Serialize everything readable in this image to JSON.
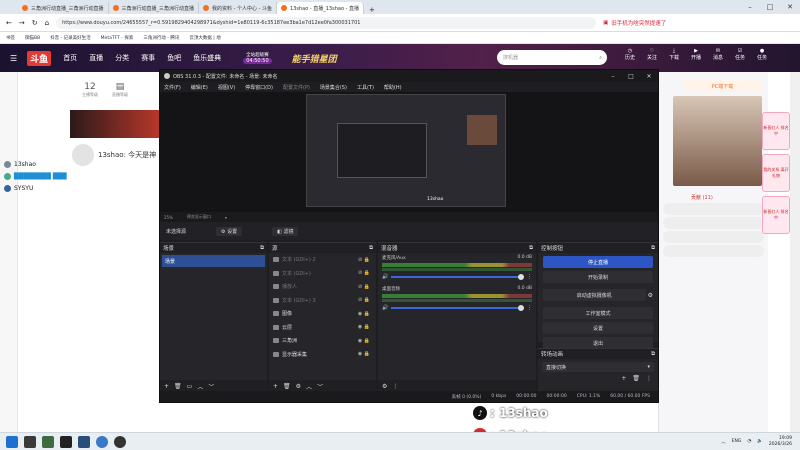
{
  "browser": {
    "tabs": [
      {
        "title": "三角洲行动直播_三角洲行动直播",
        "active": false
      },
      {
        "title": "三角洲行动直播_三角洲行动直播",
        "active": false
      },
      {
        "title": "我的资料 - 个人中心 - 斗鱼",
        "active": false
      },
      {
        "title": "13shao - 直播_13shao - 直播",
        "active": true
      }
    ],
    "url": "https://www.douyu.com/24655557_r=0.5919829404298971&dyshid=1e80119-6c35187ee3ba1e7d12ee0fa300031701",
    "url_right": "旧手机为啥突然提速了",
    "bookmarks": [
      "书签",
      "御猫BB",
      "抖音 - 记录美好生活",
      "MetaTFT - 探索",
      "三角洲行动 - 腾讯",
      "云顶大数据 | 地"
    ]
  },
  "site": {
    "logo": "斗鱼",
    "nav": [
      "首页",
      "直播",
      "分类",
      "赛事",
      "鱼吧",
      "鱼乐盛典"
    ],
    "countdown_label": "全站超级赛",
    "countdown": "04:50:50",
    "banner_text": "能手猎星团",
    "search_placeholder": "搜机器",
    "header_icons": [
      "历史",
      "关注",
      "下载",
      "开播",
      "消息",
      "任务",
      "任务"
    ],
    "room_level": "12",
    "room_level_label": "主播等级",
    "room_rank_label": "直播等级",
    "streamer_name": "13shao: 今天是神",
    "viewers": [
      {
        "name": "13shao"
      },
      {
        "name": "████████ ███"
      },
      {
        "name": "SYSYU"
      }
    ],
    "right_panel_badge": "PC端下载",
    "right_tab": "贡献 (11)",
    "ads": [
      "新晋红人 排名中",
      "我的关系 离开礼物",
      "新晋红人 排名中"
    ]
  },
  "obs": {
    "title": "OBS 31.0.3 - 配置文件: 未命名 - 场景: 未命名",
    "menu": [
      "文件(F)",
      "编辑(E)",
      "视图(V)",
      "停靠窗口(D)",
      "配置文件(P)",
      "场景集合(S)",
      "工具(T)",
      "帮助(H)"
    ],
    "preview_bar": [
      "25%",
      "预览显示窗口"
    ],
    "preview_watermark": "13shao",
    "scene_tools": {
      "label": "未选择源",
      "settings": "设置",
      "filters": "滤镜"
    },
    "docks": {
      "scenes": {
        "title": "场景",
        "items": [
          "场景"
        ]
      },
      "sources": {
        "title": "源",
        "items": [
          {
            "name": "文本 (GDI+) 2",
            "dim": true
          },
          {
            "name": "文本 (GDI+)",
            "dim": true
          },
          {
            "name": "播放人",
            "dim": true
          },
          {
            "name": "文本 (GDI+) 3",
            "dim": true
          },
          {
            "name": "图像",
            "dim": false
          },
          {
            "name": "云层",
            "dim": false
          },
          {
            "name": "三角洲",
            "dim": false
          },
          {
            "name": "显示器采集",
            "dim": false
          }
        ]
      },
      "mixer": {
        "title": "混音器",
        "channels": [
          {
            "name": "麦克风/Aux",
            "db": "0.0 dB"
          },
          {
            "name": "桌面音频",
            "db": "0.0 dB"
          }
        ]
      },
      "controls": {
        "title": "控制按钮",
        "buttons": [
          "停止直播",
          "开始录制",
          "启动虚拟摄像机",
          "工作室模式",
          "设置",
          "退出"
        ]
      },
      "transitions": {
        "title": "转场动画",
        "value": "直接切换"
      }
    },
    "status": [
      "丢帧 0 (0.0%)",
      "0 kbps",
      "00:00:00",
      "00:00:00",
      "CPU: 1.1%",
      "60.00 / 60.00 FPS"
    ]
  },
  "overlay": {
    "douyin": ": 13shao",
    "weibo": ": 13shao、"
  },
  "taskbar": {
    "lang": "ENG",
    "time": "19:09",
    "date": "2026/3/26"
  }
}
